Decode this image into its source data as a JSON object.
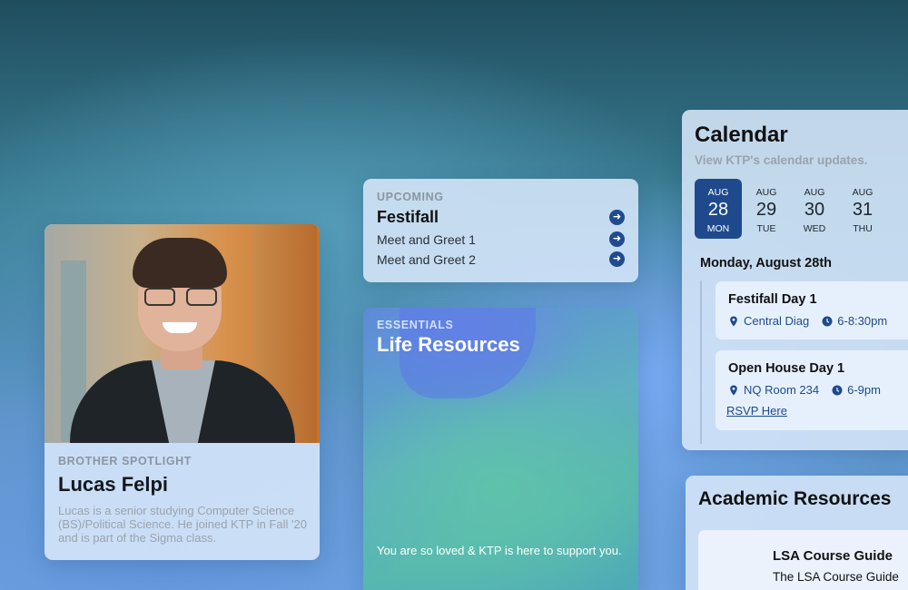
{
  "spotlight": {
    "eyebrow": "BROTHER SPOTLIGHT",
    "name": "Lucas Felpi",
    "description": "Lucas is a senior studying Computer Science (BS)/Political Science. He joined KTP in Fall '20 and is part of the Sigma class."
  },
  "upcoming": {
    "eyebrow": "UPCOMING",
    "items": [
      {
        "label": "Festifall"
      },
      {
        "label": "Meet and Greet 1"
      },
      {
        "label": "Meet and Greet 2"
      }
    ],
    "arrow_icon": "arrow-right-icon"
  },
  "essentials": {
    "eyebrow": "ESSENTIALS",
    "title": "Life Resources",
    "footer": "You are so loved & KTP is here to support you."
  },
  "calendar": {
    "title": "Calendar",
    "subtitle": "View KTP's calendar updates.",
    "days": [
      {
        "month": "AUG",
        "date": "28",
        "weekday": "MON"
      },
      {
        "month": "AUG",
        "date": "29",
        "weekday": "TUE"
      },
      {
        "month": "AUG",
        "date": "30",
        "weekday": "WED"
      },
      {
        "month": "AUG",
        "date": "31",
        "weekday": "THU"
      }
    ],
    "selected_date": "Monday, August 28th",
    "events": [
      {
        "title": "Festifall Day 1",
        "location": "Central Diag",
        "time": "6-8:30pm"
      },
      {
        "title": "Open House Day 1",
        "location": "NQ Room 234",
        "time": "6-9pm",
        "link": "RSVP Here"
      }
    ],
    "accent_color": "#1e4a8d"
  },
  "academic": {
    "title": "Academic Resources",
    "card_title": "LSA Course Guide",
    "card_desc": "The LSA Course Guide"
  }
}
